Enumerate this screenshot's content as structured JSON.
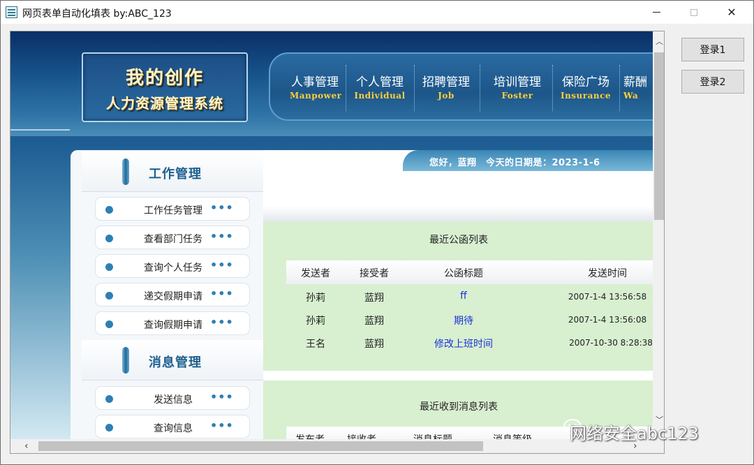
{
  "window": {
    "title": "网页表单自动化填表 by:ABC_123"
  },
  "buttons": {
    "login1": "登录1",
    "login2": "登录2"
  },
  "logo": {
    "line1": "我的创作",
    "line2": "人力资源管理系统"
  },
  "nav": [
    {
      "cn": "人事管理",
      "en": "Manpower"
    },
    {
      "cn": "个人管理",
      "en": "Individual"
    },
    {
      "cn": "招聘管理",
      "en": "Job"
    },
    {
      "cn": "培训管理",
      "en": "Foster"
    },
    {
      "cn": "保险广场",
      "en": "Insurance"
    },
    {
      "cn": "薪酬",
      "en": "Wa"
    }
  ],
  "sidebar": {
    "section1": "工作管理",
    "items1": [
      "工作任务管理",
      "查看部门任务",
      "查询个人任务",
      "递交假期申请",
      "查询假期申请"
    ],
    "section2": "消息管理",
    "items2": [
      "发送信息",
      "查询信息"
    ],
    "more": "•••"
  },
  "greeting": "您好，蓝翔　今天的日期是：2023-1-6",
  "notices": {
    "title": "最近公函列表",
    "headers": [
      "发送者",
      "接受者",
      "公函标题",
      "发送时间"
    ],
    "rows": [
      [
        "孙莉",
        "蓝翔",
        "ff",
        "2007-1-4 13:56:58"
      ],
      [
        "孙莉",
        "蓝翔",
        "期待",
        "2007-1-4 13:56:08"
      ],
      [
        "王名",
        "蓝翔",
        "修改上班时间",
        "2007-10-30 8:28:38"
      ]
    ]
  },
  "messages": {
    "title": "最近收到消息列表",
    "headers": [
      "发布者",
      "接收者",
      "消息标题",
      "消息等级"
    ]
  },
  "watermark": "网络安全abc123"
}
